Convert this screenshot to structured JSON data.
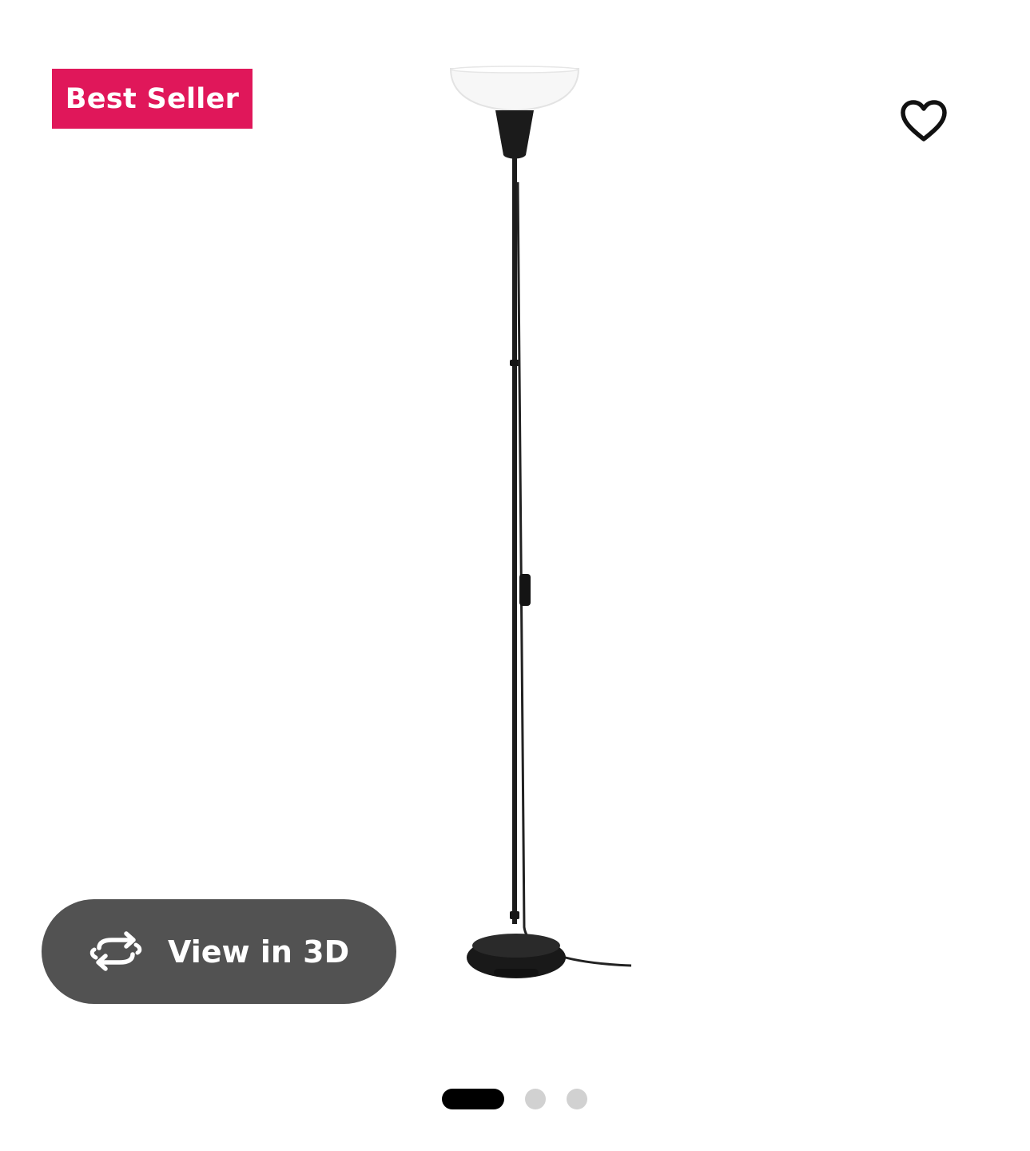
{
  "product": {
    "badge_label": "Best Seller",
    "badge_color": "#e0175a",
    "favorite_icon": "heart-outline-icon",
    "image_subject": "floor-uplight-lamp"
  },
  "viewer": {
    "view_3d_label": "View in 3D",
    "view_3d_icon": "rotate-arrows-icon"
  },
  "carousel": {
    "total_slides": 3,
    "active_index": 0
  }
}
